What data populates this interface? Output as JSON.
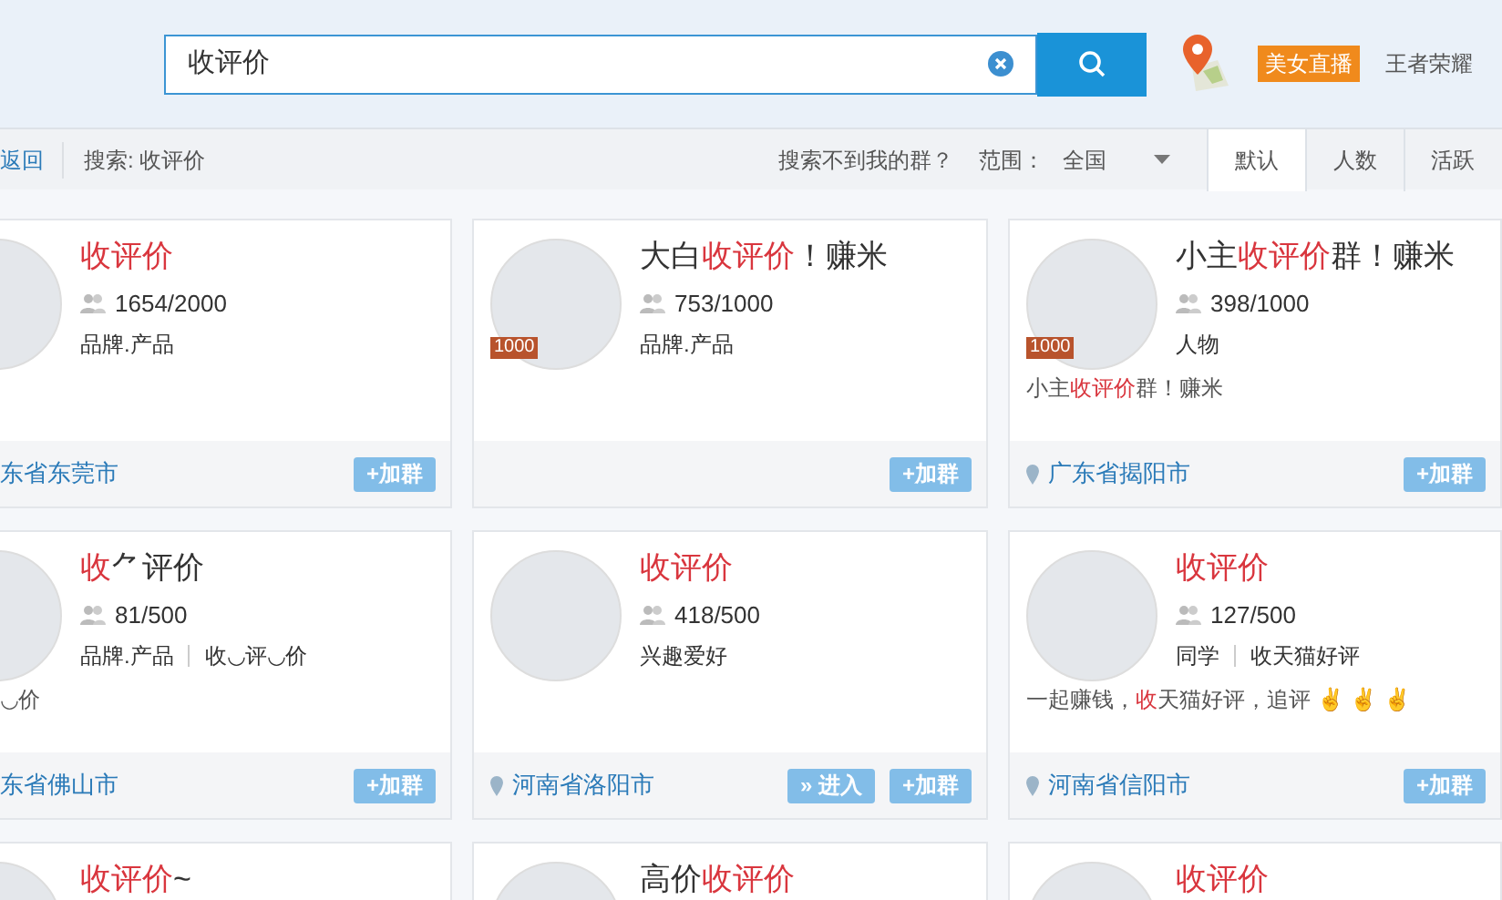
{
  "search": {
    "value": "收评价"
  },
  "header_links": [
    {
      "kind": "badge",
      "label": "美女直播"
    },
    {
      "kind": "link",
      "label": "王者荣耀"
    }
  ],
  "toolbar": {
    "back": "返回",
    "query": "搜索: 收评价",
    "help": "搜索不到我的群？",
    "range_label": "范围：",
    "range_value": "全国"
  },
  "sort_tabs": [
    {
      "label": "默认",
      "selected": true
    },
    {
      "label": "人数",
      "selected": false
    },
    {
      "label": "活跃",
      "selected": false
    }
  ],
  "groups": [
    {
      "title": [
        {
          "text": "收评价",
          "highlight": true
        }
      ],
      "members": "1654/2000",
      "tags": [
        "品牌.产品"
      ],
      "location": "东省东莞市",
      "buttons": [
        "+加群"
      ]
    },
    {
      "title": [
        {
          "text": "大白",
          "highlight": false
        },
        {
          "text": "收评价",
          "highlight": true
        },
        {
          "text": "！赚米",
          "highlight": false
        }
      ],
      "members": "753/1000",
      "tags": [
        "品牌.产品"
      ],
      "badge": "1000",
      "buttons": [
        "+加群"
      ]
    },
    {
      "title": [
        {
          "text": "小主",
          "highlight": false
        },
        {
          "text": "收评价",
          "highlight": true
        },
        {
          "text": "群！赚米",
          "highlight": false
        }
      ],
      "members": "398/1000",
      "tags": [
        "人物"
      ],
      "badge": "1000",
      "description": [
        {
          "text": "小主",
          "highlight": false
        },
        {
          "text": "收评价",
          "highlight": true
        },
        {
          "text": "群！赚米",
          "highlight": false
        }
      ],
      "location": "广东省揭阳市",
      "buttons": [
        "+加群"
      ]
    },
    {
      "title": [
        {
          "text": "收",
          "highlight": true
        },
        {
          "text": "⺈评价",
          "highlight": false
        }
      ],
      "members": "81/500",
      "tags": [
        "品牌.产品",
        "收◡评◡价"
      ],
      "description": [
        {
          "text": "◡价",
          "highlight": false
        }
      ],
      "location": "东省佛山市",
      "buttons": [
        "+加群"
      ]
    },
    {
      "title": [
        {
          "text": "收评价",
          "highlight": true
        }
      ],
      "members": "418/500",
      "tags": [
        "兴趣爱好"
      ],
      "location": "河南省洛阳市",
      "buttons": [
        "» 进入",
        "+加群"
      ]
    },
    {
      "title": [
        {
          "text": "收评价",
          "highlight": true
        }
      ],
      "members": "127/500",
      "tags": [
        "同学",
        "收天猫好评"
      ],
      "description": [
        {
          "text": "一起赚钱，",
          "highlight": false
        },
        {
          "text": "收",
          "highlight": true
        },
        {
          "text": "天猫好评，追评 ✌ ✌ ✌",
          "highlight": false
        }
      ],
      "location": "河南省信阳市",
      "buttons": [
        "+加群"
      ]
    },
    {
      "title": [
        {
          "text": "收评价",
          "highlight": true
        },
        {
          "text": "~",
          "highlight": false
        }
      ]
    },
    {
      "title": [
        {
          "text": "高价",
          "highlight": false
        },
        {
          "text": "收评价",
          "highlight": true
        }
      ]
    },
    {
      "title": [
        {
          "text": "收评价",
          "highlight": true
        }
      ]
    }
  ]
}
